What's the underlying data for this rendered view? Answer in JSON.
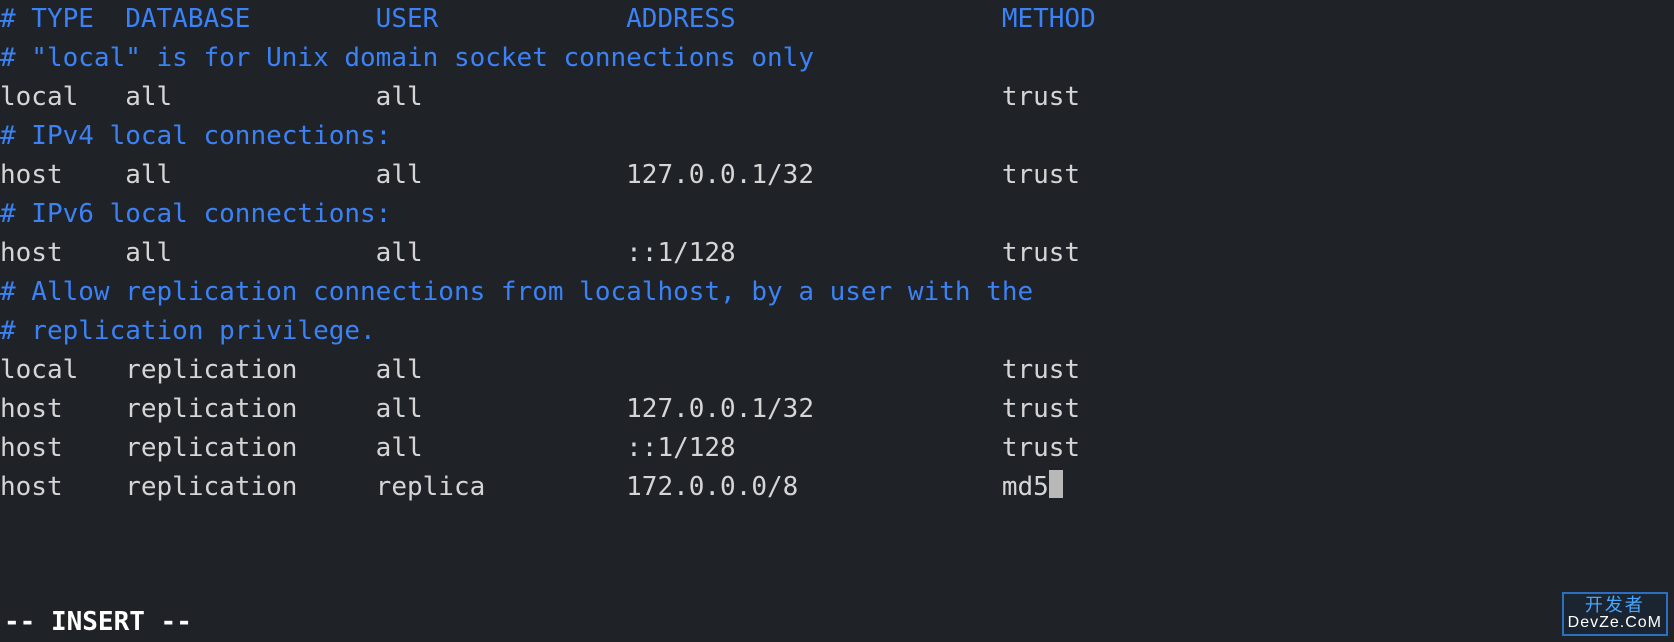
{
  "lines": [
    {
      "cls": "comment",
      "text": "# TYPE  DATABASE        USER            ADDRESS                 METHOD"
    },
    {
      "cls": "plain",
      "text": ""
    },
    {
      "cls": "comment",
      "text": "# \"local\" is for Unix domain socket connections only"
    },
    {
      "cls": "plain",
      "text": "local   all             all                                     trust"
    },
    {
      "cls": "comment",
      "text": "# IPv4 local connections:"
    },
    {
      "cls": "plain",
      "text": "host    all             all             127.0.0.1/32            trust"
    },
    {
      "cls": "comment",
      "text": "# IPv6 local connections:"
    },
    {
      "cls": "plain",
      "text": "host    all             all             ::1/128                 trust"
    },
    {
      "cls": "comment",
      "text": "# Allow replication connections from localhost, by a user with the"
    },
    {
      "cls": "comment",
      "text": "# replication privilege."
    },
    {
      "cls": "plain",
      "text": "local   replication     all                                     trust"
    },
    {
      "cls": "plain",
      "text": "host    replication     all             127.0.0.1/32            trust"
    },
    {
      "cls": "plain",
      "text": "host    replication     all             ::1/128                 trust"
    },
    {
      "cls": "plain",
      "text": "host    replication     replica         172.0.0.0/8             md5",
      "cursor": true
    }
  ],
  "status": {
    "mode": "INSERT"
  },
  "watermark": {
    "line1": "开发者",
    "line2": "DevZe.CoM"
  }
}
